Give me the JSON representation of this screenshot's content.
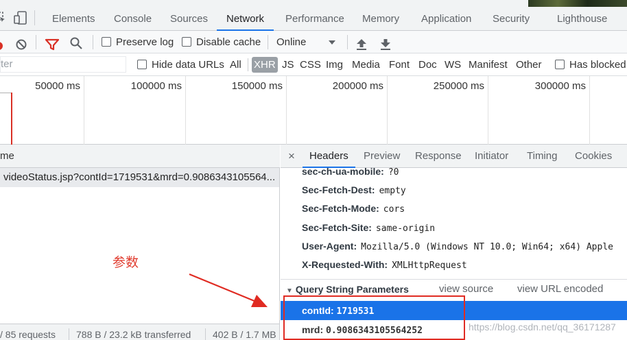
{
  "devtools_tabs": [
    {
      "label": "Elements"
    },
    {
      "label": "Console"
    },
    {
      "label": "Sources"
    },
    {
      "label": "Network",
      "active": true
    },
    {
      "label": "Performance"
    },
    {
      "label": "Memory"
    },
    {
      "label": "Application"
    },
    {
      "label": "Security"
    },
    {
      "label": "Lighthouse"
    }
  ],
  "toolbar": {
    "preserve_log": "Preserve log",
    "disable_cache": "Disable cache",
    "throttle": "Online",
    "icons": [
      "record-icon",
      "clear-icon",
      "filter-icon",
      "search-icon",
      "upload-icon",
      "download-icon"
    ]
  },
  "filter_bar": {
    "filter_placeholder": "ter",
    "hide_data_urls": "Hide data URLs",
    "types": [
      "All",
      "XHR",
      "JS",
      "CSS",
      "Img",
      "Media",
      "Font",
      "Doc",
      "WS",
      "Manifest",
      "Other"
    ],
    "active_type": "XHR",
    "has_blocked": "Has blocked"
  },
  "timeline": {
    "ticks": [
      "50000 ms",
      "100000 ms",
      "150000 ms",
      "200000 ms",
      "250000 ms",
      "300000 ms"
    ]
  },
  "request_list": {
    "column_header": "me",
    "rows": [
      {
        "name": "videoStatus.jsp?contId=1719531&mrd=0.9086343105564..."
      }
    ]
  },
  "statusbar": {
    "requests": "/ 85 requests",
    "transferred": "788 B / 23.2 kB transferred",
    "resources": "402 B / 1.7 MB"
  },
  "annotation": {
    "label": "参数",
    "color": "#e03b2e"
  },
  "details": {
    "close_label": "×",
    "tabs": [
      {
        "label": "Headers",
        "active": true
      },
      {
        "label": "Preview"
      },
      {
        "label": "Response"
      },
      {
        "label": "Initiator"
      },
      {
        "label": "Timing"
      },
      {
        "label": "Cookies"
      }
    ],
    "headers": [
      {
        "key": "sec-ch-ua-mobile:",
        "value": "?0"
      },
      {
        "key": "Sec-Fetch-Dest:",
        "value": "empty"
      },
      {
        "key": "Sec-Fetch-Mode:",
        "value": "cors"
      },
      {
        "key": "Sec-Fetch-Site:",
        "value": "same-origin"
      },
      {
        "key": "User-Agent:",
        "value": "Mozilla/5.0 (Windows NT 10.0; Win64; x64) Apple"
      },
      {
        "key": "X-Requested-With:",
        "value": "XMLHttpRequest"
      }
    ],
    "query_section": {
      "title": "Query String Parameters",
      "view_source": "view source",
      "view_url_encoded": "view URL encoded"
    },
    "params": [
      {
        "key": "contId:",
        "value": "1719531",
        "selected": true
      },
      {
        "key": "mrd:",
        "value": "0.9086343105564252",
        "selected": false
      }
    ]
  },
  "watermark": "https://blog.csdn.net/qq_36171287",
  "colors": {
    "accent": "#1a73e8",
    "annotation_red": "#e02b22"
  }
}
